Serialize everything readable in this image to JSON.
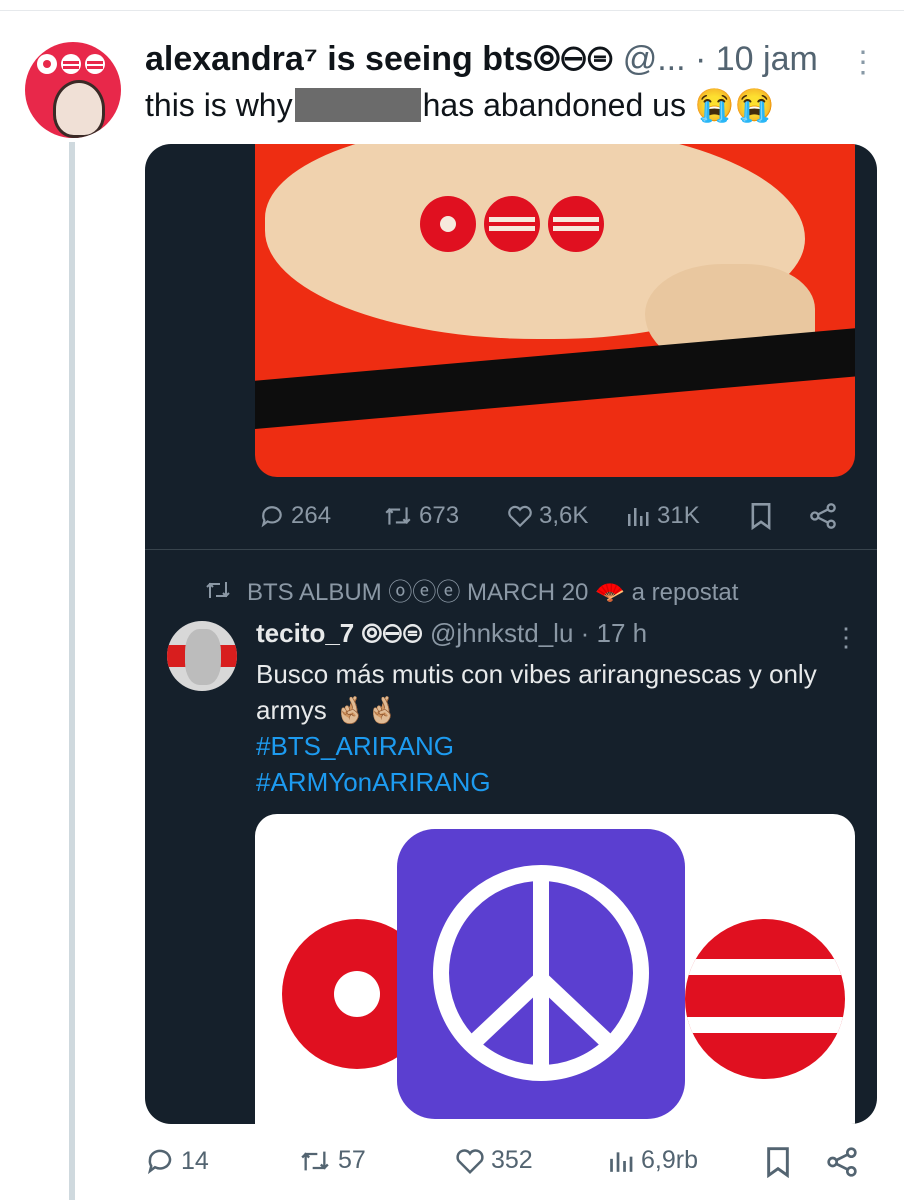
{
  "tweet": {
    "display_name": "alexandra⁷ is seeing bts⦾⊖⊜",
    "handle": "@...",
    "time": "· 10 jam",
    "text_before": "this is why",
    "text_after": "has abandoned us 😭😭"
  },
  "inner_actions": {
    "replies": "264",
    "reposts": "673",
    "likes": "3,6K",
    "views": "31K"
  },
  "repost": {
    "label": "BTS ALBUM ⓞⓔⓔ MARCH 20",
    "emoji": "🪭",
    "suffix": "a repostat"
  },
  "quoted": {
    "display_name": "tecito_7 ⦾⊖⊜",
    "handle": "@jhnkstd_lu",
    "time": "· 17 h",
    "text": "Busco más mutis con vibes arirangnescas y only armys 🤞🏼🤞🏼",
    "hashtags": [
      "#BTS_ARIRANG",
      "#ARMYonARIRANG"
    ]
  },
  "bottom_actions": {
    "replies": "14",
    "reposts": "57",
    "likes": "352",
    "views": "6,9rb"
  },
  "colors": {
    "accent_link": "#1d9bf0",
    "dark_card": "#15202b",
    "brand_red": "#e01020",
    "app_purple": "#5b3fd0"
  }
}
